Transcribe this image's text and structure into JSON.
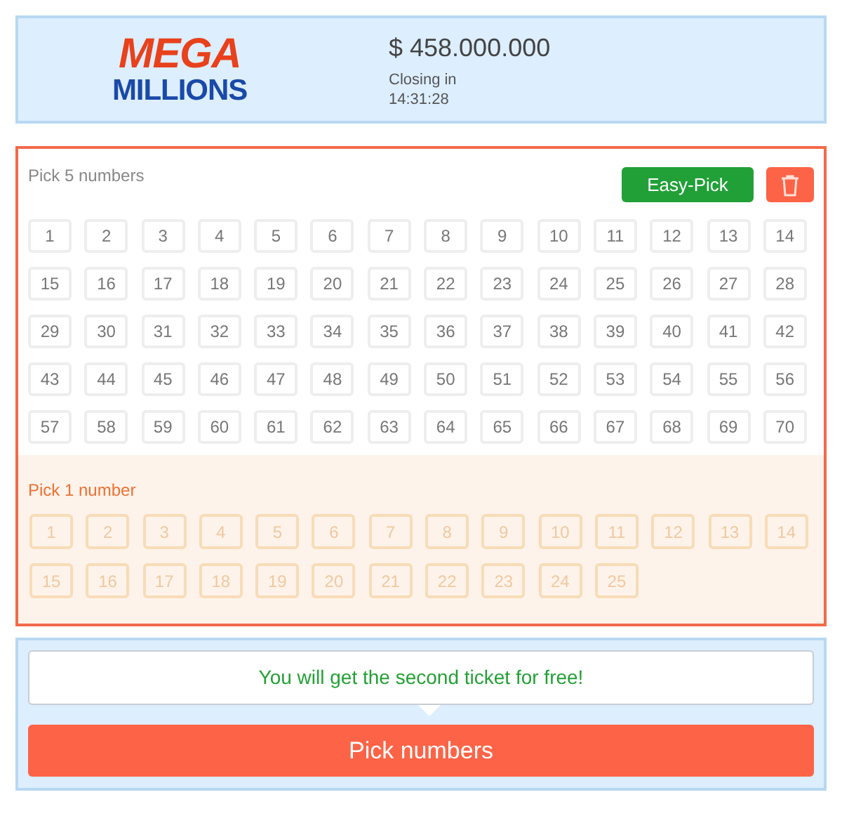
{
  "header": {
    "logo": {
      "line_1": "MEGA",
      "line_2": "MILLIONS"
    },
    "jackpot": "$ 458.000.000",
    "closing_label": "Closing in",
    "closing_time": "14:31:28"
  },
  "main_pick": {
    "title": "Pick 5 numbers",
    "easy_pick_button": "Easy-Pick",
    "numbers": [
      "1",
      "2",
      "3",
      "4",
      "5",
      "6",
      "7",
      "8",
      "9",
      "10",
      "11",
      "12",
      "13",
      "14",
      "15",
      "16",
      "17",
      "18",
      "19",
      "20",
      "21",
      "22",
      "23",
      "24",
      "25",
      "26",
      "27",
      "28",
      "29",
      "30",
      "31",
      "32",
      "33",
      "34",
      "35",
      "36",
      "37",
      "38",
      "39",
      "40",
      "41",
      "42",
      "43",
      "44",
      "45",
      "46",
      "47",
      "48",
      "49",
      "50",
      "51",
      "52",
      "53",
      "54",
      "55",
      "56",
      "57",
      "58",
      "59",
      "60",
      "61",
      "62",
      "63",
      "64",
      "65",
      "66",
      "67",
      "68",
      "69",
      "70"
    ]
  },
  "bonus_pick": {
    "title": "Pick 1 number",
    "numbers": [
      "1",
      "2",
      "3",
      "4",
      "5",
      "6",
      "7",
      "8",
      "9",
      "10",
      "11",
      "12",
      "13",
      "14",
      "15",
      "16",
      "17",
      "18",
      "19",
      "20",
      "21",
      "22",
      "23",
      "24",
      "25"
    ]
  },
  "footer": {
    "promo": "You will get the second ticket for free!",
    "submit_button": "Pick numbers"
  }
}
